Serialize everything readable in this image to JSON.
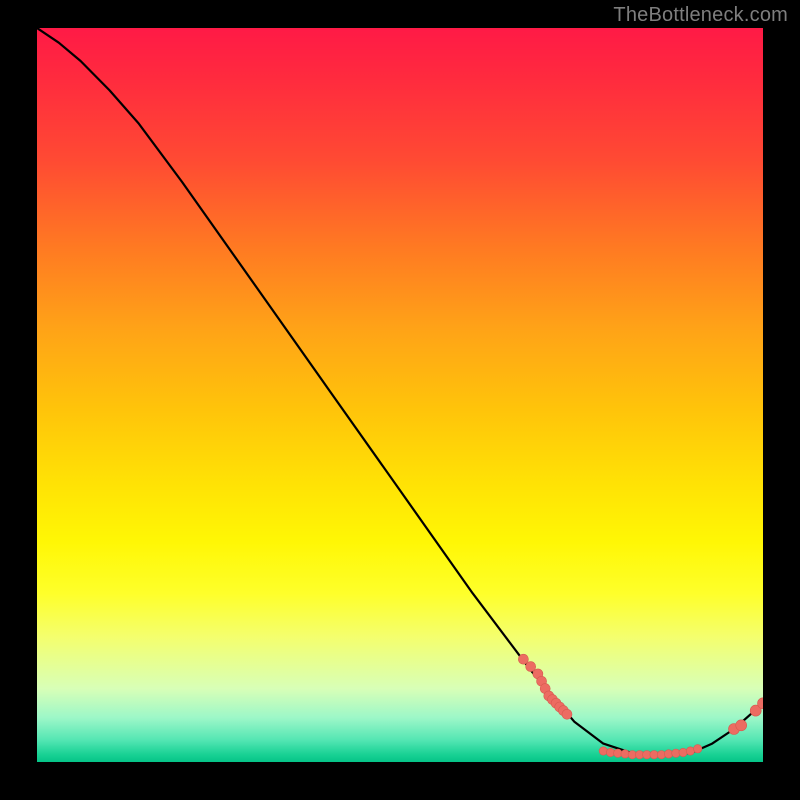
{
  "watermark": "TheBottleneck.com",
  "colors": {
    "dot": "#ec6c62",
    "line": "#000000"
  },
  "chart_data": {
    "type": "line",
    "title": "",
    "xlabel": "",
    "ylabel": "",
    "xlim": [
      0,
      100
    ],
    "ylim": [
      0,
      100
    ],
    "grid": false,
    "legend": false,
    "series": [
      {
        "name": "bottleneck-curve",
        "x": [
          0,
          3,
          6,
          10,
          14,
          20,
          30,
          40,
          50,
          60,
          68,
          74,
          78,
          82,
          86,
          90,
          93,
          96,
          100
        ],
        "y": [
          100,
          98,
          95.5,
          91.5,
          87,
          79,
          65,
          51,
          37,
          23,
          12.5,
          5.5,
          2.5,
          1.2,
          1.0,
          1.2,
          2.5,
          4.5,
          8
        ]
      }
    ],
    "points": [
      {
        "name": "cluster-descent",
        "x_values": [
          67,
          68,
          69,
          69.5,
          70,
          70.5,
          71,
          71.5,
          72,
          72.5,
          73
        ],
        "y_values": [
          14,
          13,
          12,
          11,
          10,
          9,
          8.5,
          8,
          7.5,
          7,
          6.5
        ]
      },
      {
        "name": "cluster-valley",
        "x_values": [
          78,
          79,
          80,
          81,
          82,
          83,
          84,
          85,
          86,
          87,
          88,
          89,
          90,
          91
        ],
        "y_values": [
          1.5,
          1.3,
          1.2,
          1.1,
          1.0,
          1.0,
          1.0,
          1.0,
          1.0,
          1.1,
          1.2,
          1.3,
          1.5,
          1.8
        ]
      },
      {
        "name": "cluster-rise",
        "x_values": [
          96,
          97,
          99,
          100
        ],
        "y_values": [
          4.5,
          5.0,
          7.0,
          8.0
        ]
      }
    ]
  }
}
